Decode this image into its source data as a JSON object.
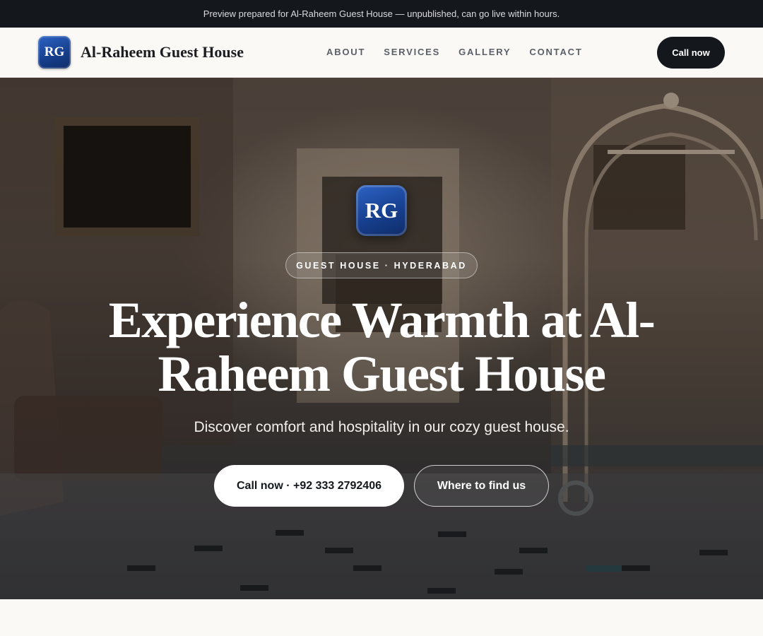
{
  "announcement": {
    "text": "Preview prepared for Al-Raheem Guest House — unpublished, can go live within hours."
  },
  "header": {
    "logo_initials": "RG",
    "brand_name": "Al-Raheem Guest House",
    "nav": [
      {
        "label": "ABOUT"
      },
      {
        "label": "SERVICES"
      },
      {
        "label": "GALLERY"
      },
      {
        "label": "CONTACT"
      }
    ],
    "cta_label": "Call now"
  },
  "hero": {
    "logo_initials": "RG",
    "eyebrow": "GUEST HOUSE · HYDERABAD",
    "title": "Experience Warmth at Al-Raheem Guest House",
    "subtitle": "Discover comfort and hospitality in our cozy guest house.",
    "primary_button": "Call now · +92 333 2792406",
    "secondary_button": "Where to find us",
    "background_image": "hotel lobby with framed paintings, armchair and brass luggage cart"
  },
  "colors": {
    "dark": "#14171c",
    "logo_blue": "#17408f",
    "page_bg": "#faf9f6"
  }
}
